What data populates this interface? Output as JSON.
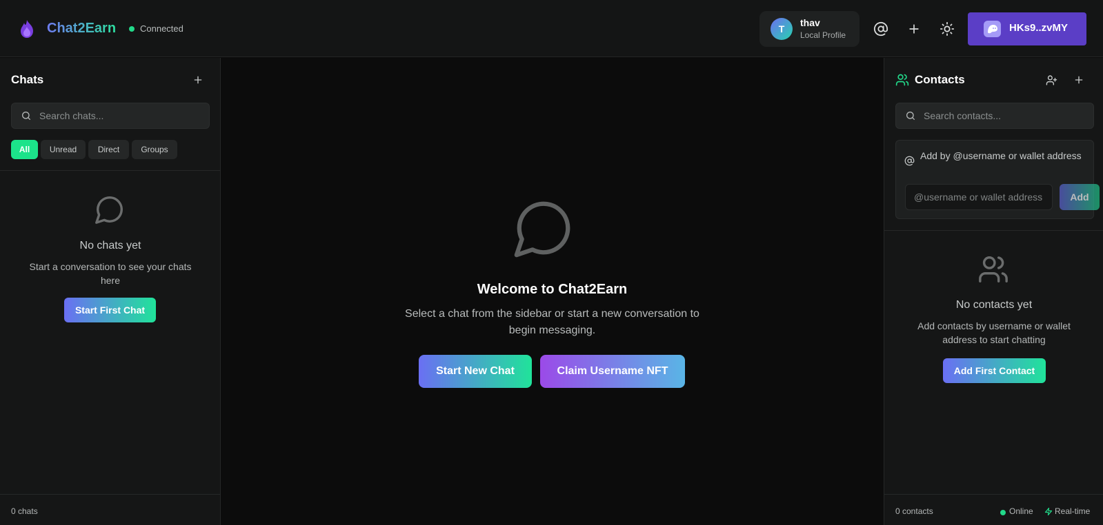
{
  "header": {
    "app_title": "Chat2Earn",
    "connection_status": "Connected",
    "profile": {
      "initial": "T",
      "name": "thav",
      "subtitle": "Local Profile"
    },
    "wallet_label": "HKs9..zvMY"
  },
  "chats_panel": {
    "title": "Chats",
    "search_placeholder": "Search chats...",
    "filters": [
      "All",
      "Unread",
      "Direct",
      "Groups"
    ],
    "active_filter": "All",
    "empty_title": "No chats yet",
    "empty_subtitle": "Start a conversation to see your chats here",
    "cta_label": "Start First Chat",
    "footer_count": "0 chats"
  },
  "main": {
    "welcome_title": "Welcome to Chat2Earn",
    "welcome_subtitle": "Select a chat from the sidebar or start a new conversation to begin messaging.",
    "start_chat_label": "Start New Chat",
    "claim_nft_label": "Claim Username NFT"
  },
  "contacts_panel": {
    "title": "Contacts",
    "search_placeholder": "Search contacts...",
    "add_label": "Add by @username or wallet address",
    "add_input_placeholder": "@username or wallet address",
    "add_button": "Add",
    "empty_title": "No contacts yet",
    "empty_subtitle": "Add contacts by username or wallet address to start chatting",
    "cta_label": "Add First Contact",
    "footer_count": "0 contacts",
    "online_label": "Online",
    "realtime_label": "Real-time"
  },
  "colors": {
    "accent_green": "#22d98a",
    "wallet_purple": "#5b3ec6",
    "gradient_start": "#6a6ff3",
    "gradient_end": "#20e39a"
  },
  "icons": {
    "logo": "flame-icon",
    "mention": "at-icon",
    "add": "plus-icon",
    "theme": "sun-icon",
    "wallet": "ghost-icon",
    "search": "search-icon",
    "chat": "message-circle-icon",
    "contacts": "users-icon",
    "add_contact": "user-plus-icon",
    "realtime": "zap-icon"
  }
}
